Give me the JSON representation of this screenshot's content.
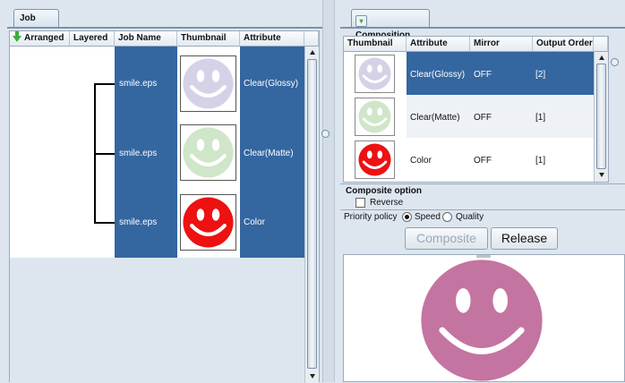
{
  "job_list": {
    "tab_label": "Job List",
    "columns": {
      "arranged": "Arranged",
      "layered": "Layered",
      "job_name": "Job Name",
      "thumbnail": "Thumbnail",
      "attribute": "Attribute"
    },
    "rows": [
      {
        "job_name": "smile.eps",
        "attribute": "Clear(Glossy)",
        "thumb_color": "#d5d2e8"
      },
      {
        "job_name": "smile.eps",
        "attribute": "Clear(Matte)",
        "thumb_color": "#cfe6c8"
      },
      {
        "job_name": "smile.eps",
        "attribute": "Color",
        "thumb_color": "#ee1111"
      }
    ]
  },
  "composition": {
    "tab_label": "Composition",
    "columns": {
      "thumbnail": "Thumbnail",
      "attribute": "Attribute",
      "mirror": "Mirror",
      "output_order": "Output Order"
    },
    "rows": [
      {
        "attribute": "Clear(Glossy)",
        "mirror": "OFF",
        "output_order": "[2]",
        "selected": true,
        "thumb_color": "#d5d2e8"
      },
      {
        "attribute": "Clear(Matte)",
        "mirror": "OFF",
        "output_order": "[1]",
        "selected": false,
        "thumb_color": "#cfe6c8"
      },
      {
        "attribute": "Color",
        "mirror": "OFF",
        "output_order": "[1]",
        "selected": false,
        "thumb_color": "#ee1111"
      }
    ],
    "composite_option_label": "Composite option",
    "reverse_label": "Reverse",
    "priority_label": "Priority policy",
    "priority_options": [
      "Speed",
      "Quality"
    ],
    "priority_selected": "Speed",
    "composite_button": "Composite",
    "release_button": "Release",
    "preview_color": "#c474a0"
  },
  "colors": {
    "selection_blue": "#3466a0",
    "background": "#dde6ee"
  }
}
